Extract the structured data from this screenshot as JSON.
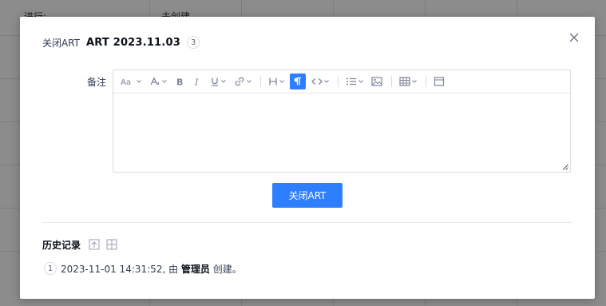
{
  "background": {
    "cells": [
      "进行:",
      "未创建"
    ]
  },
  "modal": {
    "header": {
      "label": "关闭ART",
      "title": "ART 2023.11.03",
      "badge": "3"
    },
    "form": {
      "remark_label": "备注",
      "remark_value": ""
    },
    "toolbar": {
      "items": [
        {
          "name": "font-size-icon",
          "label": "Aa"
        },
        {
          "name": "color-icon"
        },
        {
          "name": "bold-icon",
          "label": "B"
        },
        {
          "name": "italic-icon",
          "label": "I"
        },
        {
          "name": "underline-icon",
          "label": "U"
        },
        {
          "name": "link-icon"
        },
        {
          "name": "heading-icon",
          "label": "H"
        },
        {
          "name": "paragraph-icon",
          "label": "¶"
        },
        {
          "name": "code-icon"
        },
        {
          "name": "list-icon"
        },
        {
          "name": "image-icon"
        },
        {
          "name": "table-icon"
        },
        {
          "name": "fullscreen-icon"
        }
      ]
    },
    "submit_label": "关闭ART",
    "history": {
      "title": "历史记录",
      "items": [
        {
          "index": "1",
          "text_before": "2023-11-01 14:31:52, 由 ",
          "actor": "管理员",
          "text_after": " 创建。"
        }
      ]
    }
  }
}
